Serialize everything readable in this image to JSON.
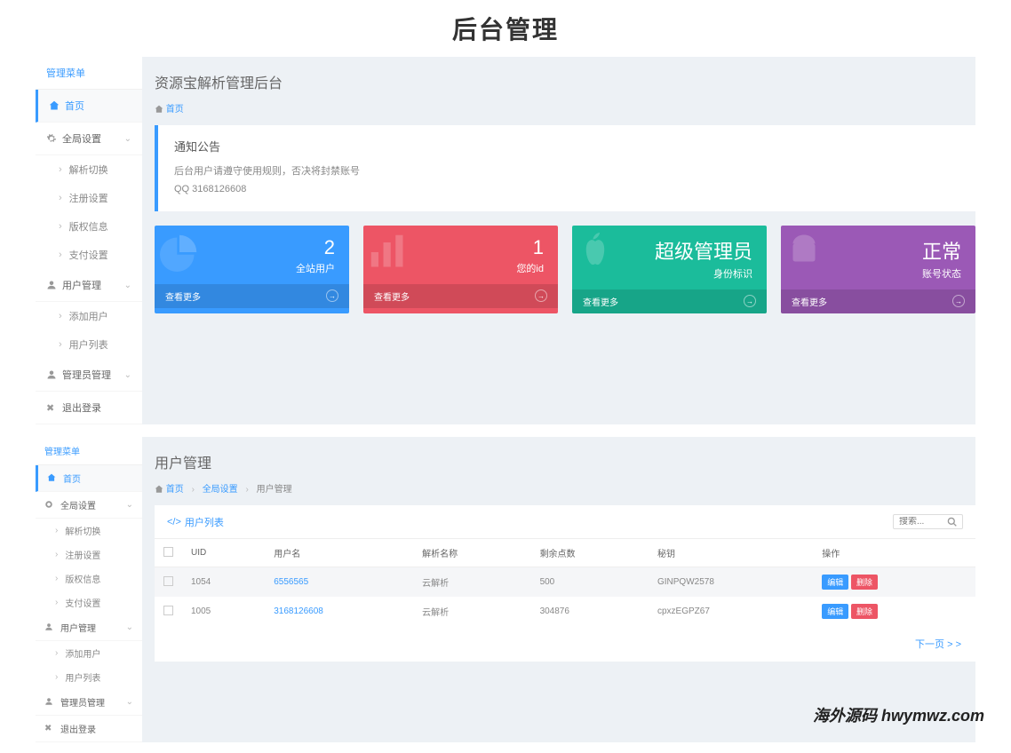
{
  "header_title": "后台管理",
  "sidebar": {
    "header": "管理菜单",
    "home": "首页",
    "global": "全局设置",
    "global_sub": [
      "解析切换",
      "注册设置",
      "版权信息",
      "支付设置"
    ],
    "user": "用户管理",
    "user_sub": [
      "添加用户",
      "用户列表"
    ],
    "admin": "管理员管理",
    "logout": "退出登录"
  },
  "dashboard": {
    "title": "资源宝解析管理后台",
    "breadcrumb_home": "首页",
    "notice_title": "通知公告",
    "notice_line1": "后台用户请遵守使用规则，否决将封禁账号",
    "notice_line2": "QQ 3168126608",
    "stats": [
      {
        "value": "2",
        "label": "全站用户",
        "footer": "查看更多",
        "color": "c-blue"
      },
      {
        "value": "1",
        "label": "您的id",
        "footer": "查看更多",
        "color": "c-red"
      },
      {
        "value": "超级管理员",
        "label": "身份标识",
        "footer": "查看更多",
        "color": "c-teal"
      },
      {
        "value": "正常",
        "label": "账号状态",
        "footer": "查看更多",
        "color": "c-purple"
      }
    ]
  },
  "userpage": {
    "title": "用户管理",
    "breadcrumb": {
      "home": "首页",
      "global": "全局设置",
      "current": "用户管理"
    },
    "panel_title": "用户列表",
    "search_placeholder": "搜索...",
    "columns": [
      "UID",
      "用户名",
      "解析名称",
      "剩余点数",
      "秘钥",
      "操作"
    ],
    "rows": [
      {
        "uid": "1054",
        "username": "6556565",
        "parser": "云解析",
        "points": "500",
        "key": "GINPQW2578"
      },
      {
        "uid": "1005",
        "username": "3168126608",
        "parser": "云解析",
        "points": "304876",
        "key": "cpxzEGPZ67"
      }
    ],
    "btn_edit": "编辑",
    "btn_delete": "删除",
    "next_page": "下一页 > >"
  },
  "watermark": "海外源码 hwymwz.com"
}
